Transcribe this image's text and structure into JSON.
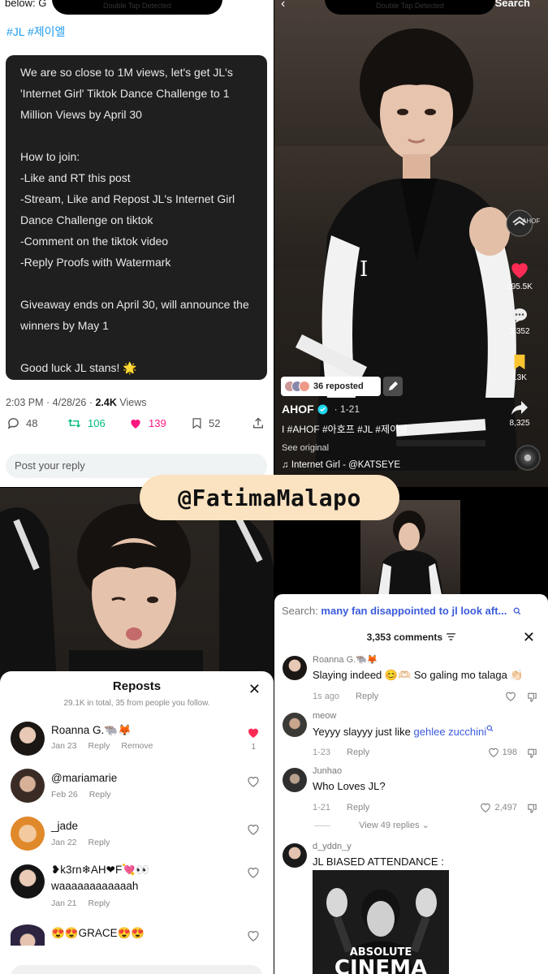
{
  "tweet": {
    "top_text": "below: G",
    "notch_text": "Double Tap Detected",
    "hashtags": "#JL #제이엘",
    "body": "We are so close to 1M views, let's get JL's 'Internet Girl' Tiktok Dance Challenge to 1 Million Views by April 30\n\nHow to join:\n-Like and RT this post\n-Stream, Like and Repost JL's Internet Girl Dance Challenge on tiktok\n-Comment on the tiktok video\n-Reply Proofs with Watermark\n\nGiveaway ends on April 30, will announce the winners by May 1\n\nGood luck JL stans! 🌟",
    "time": "2:03 PM · 4/28/26 · ",
    "views_count": "2.4K",
    "views_label": " Views",
    "replies": "48",
    "retweets": "106",
    "likes": "139",
    "bookmarks": "52",
    "reply_placeholder": "Post your reply",
    "colors": {
      "retweet": "#00ba7c",
      "like": "#f91880",
      "link": "#1d9bf0"
    }
  },
  "video": {
    "notch_text": "Double Tap Detected",
    "search_label": "Search",
    "side_badge": "AHOF",
    "likes": "195.5K",
    "comments": "3,352",
    "saves": "13K",
    "shares": "8,325",
    "reposted": "36 reposted",
    "author": "AHOF",
    "date": "· 1-21",
    "caption": "I  #AHOF #아호프 #JL #제이엘",
    "see_original": "See original",
    "song": "♫ Internet Girl - @KATSEYE"
  },
  "reposts": {
    "title": "Reposts",
    "subtitle": "29.1K in total, 35 from people you follow.",
    "reply_label": "Reply",
    "remove_label": "Remove",
    "items": [
      {
        "name": "Roanna G.🐃🦊",
        "date": "Jan 23",
        "liked": true,
        "count": "1"
      },
      {
        "name": "@mariamarie",
        "date": "Feb 26",
        "liked": false
      },
      {
        "name": "_jade",
        "date": "Jan 22",
        "liked": false
      },
      {
        "name": "❥k3rn❄AH❤F💘👀",
        "extra": "waaaaaaaaaaaah",
        "date": "Jan 21",
        "liked": false
      },
      {
        "name": "😍😍GRACE😍😍",
        "liked": false
      }
    ]
  },
  "comments": {
    "search_prefix": "Search: ",
    "search_query": "many fan disappointed to jl look aft...",
    "header": "3,353 comments",
    "reply_label": "Reply",
    "items": [
      {
        "user": "Roanna G.🐃🦊",
        "text": "Slaying indeed 😊🫶🏻 So galing mo talaga 👏🏻",
        "time": "1s ago",
        "likes": ""
      },
      {
        "user": "meow",
        "text": "Yeyyy slayyy just like ",
        "link": "gehlee zucchini",
        "time": "1-23",
        "likes": "198"
      },
      {
        "user": "Junhao",
        "text": "Who Loves JL?",
        "time": "1-21",
        "likes": "2,497",
        "view_replies": "View 49 replies"
      },
      {
        "user": "d_yddn_y",
        "text": "JL BIASED ATTENDANCE :"
      }
    ],
    "image_text_1": "ABSOLUTE",
    "image_text_2": "CINEMA"
  },
  "watermark": "@FatimaMalapo"
}
